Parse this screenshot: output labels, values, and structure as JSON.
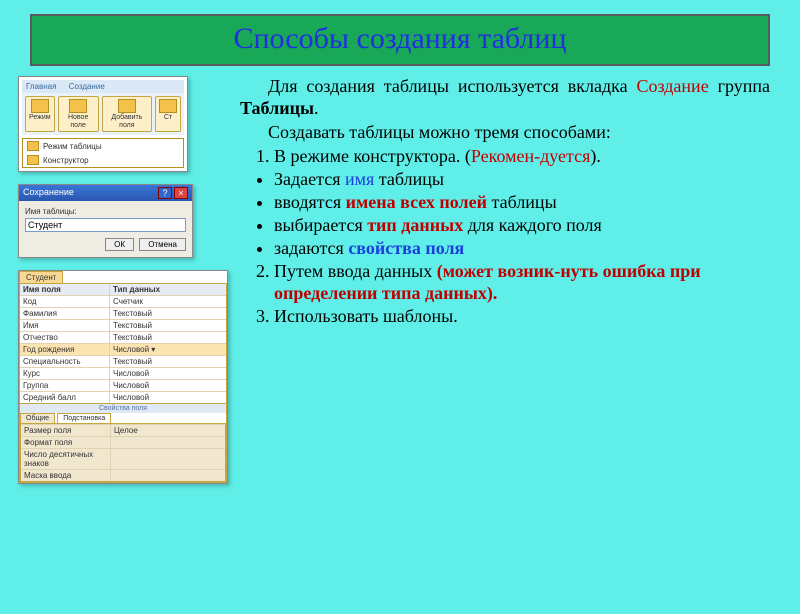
{
  "title": "Способы создания таблиц",
  "ribbon": {
    "tab1": "Главная",
    "tab2": "Создание",
    "btn_mode": "Режим",
    "btn_new": "Новое поле",
    "btn_add": "Добавить поля",
    "btn_col": "Ст",
    "dd1": "Режим таблицы",
    "dd2": "Конструктор"
  },
  "dialog": {
    "title": "Сохранение",
    "label": "Имя таблицы:",
    "value": "Студент",
    "ok": "ОК",
    "cancel": "Отмена"
  },
  "designer": {
    "tab": "Студент",
    "col1": "Имя поля",
    "col2": "Тип данных",
    "rows": [
      {
        "f": "Код",
        "t": "Счетчик"
      },
      {
        "f": "Фамилия",
        "t": "Текстовый"
      },
      {
        "f": "Имя",
        "t": "Текстовый"
      },
      {
        "f": "Отчество",
        "t": "Текстовый"
      },
      {
        "f": "Год рождения",
        "t": "Числовой"
      },
      {
        "f": "Специальность",
        "t": "Текстовый"
      },
      {
        "f": "Курс",
        "t": "Числовой"
      },
      {
        "f": "Группа",
        "t": "Числовой"
      },
      {
        "f": "Средний балл",
        "t": "Числовой"
      }
    ],
    "props_title": "Свойства поля",
    "ptab1": "Общие",
    "ptab2": "Подстановка",
    "prow1f": "Размер поля",
    "prow1v": "Целое",
    "prow2f": "Формат поля",
    "prow3f": "Число десятичных знаков",
    "prow4f": "Маска ввода"
  },
  "text": {
    "p1a": "Для создания таблицы используется вкладка ",
    "p1b": "Создание",
    "p1c": " группа ",
    "p1d": "Таблицы",
    "p1e": ".",
    "p2": "Создавать таблицы можно тремя способами:",
    "li1a": "В режиме конструктора. (",
    "li1b": "Рекомен-дуется",
    "li1c": ").",
    "s1a": "Задается ",
    "s1b": "имя",
    "s1c": " таблицы",
    "s2a": "вводятся ",
    "s2b": "имена всех полей",
    "s2c": " таблицы",
    "s3a": "выбирается ",
    "s3b": "тип данных",
    "s3c": " для каждого поля",
    "s4a": "задаются ",
    "s4b": "свойства поля",
    "li2a": "Путем ввода данных ",
    "li2b": "(может возник-нуть ошибка при определении типа данных).",
    "li3": "Использовать шаблоны."
  }
}
